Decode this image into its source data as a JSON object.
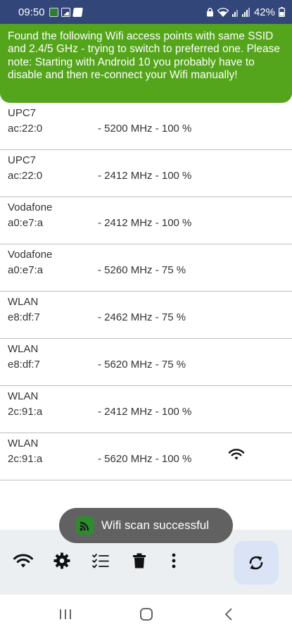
{
  "status_bar": {
    "time": "09:50",
    "battery": "42%"
  },
  "banner": {
    "message": "Found the following Wifi access points with same SSID and 2.4/5 GHz - trying to switch to preferred one. Please note: Starting with Android 10 you probably have to disable and then re-connect your Wifi manually!"
  },
  "networks": [
    {
      "ssid": "UPC7",
      "mac": "ac:22:0",
      "info": "- 5200 MHz - 100 %",
      "connected": false
    },
    {
      "ssid": "UPC7",
      "mac": "ac:22:0",
      "info": "- 2412 MHz - 100 %",
      "connected": false
    },
    {
      "ssid": "Vodafone",
      "mac": "a0:e7:a",
      "info": "- 2412 MHz - 100 %",
      "connected": false
    },
    {
      "ssid": "Vodafone",
      "mac": "a0:e7:a",
      "info": "- 5260 MHz - 75 %",
      "connected": false
    },
    {
      "ssid": "WLAN",
      "mac": "e8:df:7",
      "info": "- 2462 MHz - 75 %",
      "connected": false
    },
    {
      "ssid": "WLAN",
      "mac": "e8:df:7",
      "info": "- 5620 MHz - 75 %",
      "connected": false
    },
    {
      "ssid": "WLAN",
      "mac": "2c:91:a",
      "info": "- 2412 MHz - 100 %",
      "connected": false
    },
    {
      "ssid": "WLAN",
      "mac": "2c:91:a",
      "info": "- 5620 MHz - 100 %",
      "connected": true
    }
  ],
  "toast": {
    "message": "Wifi scan successful"
  },
  "toolbar": {
    "icons": [
      "wifi-icon",
      "gear-icon",
      "checklist-icon",
      "trash-icon",
      "more-vert-icon",
      "refresh-icon"
    ]
  },
  "colors": {
    "status_bar": "#33467a",
    "banner": "#55a51c",
    "toast": "#616161",
    "fab": "#dbe3f7",
    "bottom_bar": "#eceff1"
  }
}
